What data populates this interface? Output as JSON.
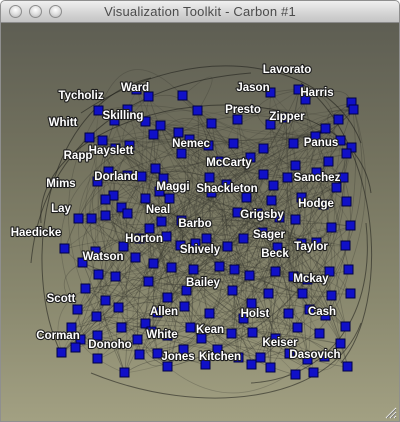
{
  "window": {
    "title": "Visualization Toolkit - Carbon #1"
  },
  "colors": {
    "node_fill": "#1010c8",
    "node_stroke": "#000044",
    "edge": "#3a3a32",
    "label_fill": "#ffffff",
    "label_outline": "#1e1e1e"
  },
  "graph": {
    "labels": [
      "Lavorato",
      "Ward",
      "Jason",
      "Tycholiz",
      "Harris",
      "Skilling",
      "Presto",
      "Zipper",
      "Whitt",
      "Panus",
      "Nemec",
      "Hayslett",
      "Rapp",
      "McCarty",
      "Sanchez",
      "Maggi",
      "Dorland",
      "Mims",
      "Shackleton",
      "Hodge",
      "Lay",
      "Neal",
      "Grigsby",
      "Barbo",
      "Haedicke",
      "Horton",
      "Sager",
      "Taylor",
      "Watson",
      "Shively",
      "Beck",
      "Mckay",
      "Bailey",
      "Scott",
      "Allen",
      "Holst",
      "Cash",
      "Kean",
      "Corman",
      "White",
      "Donoho",
      "Keiser",
      "Jones",
      "Kitchen",
      "Dasovich"
    ]
  }
}
